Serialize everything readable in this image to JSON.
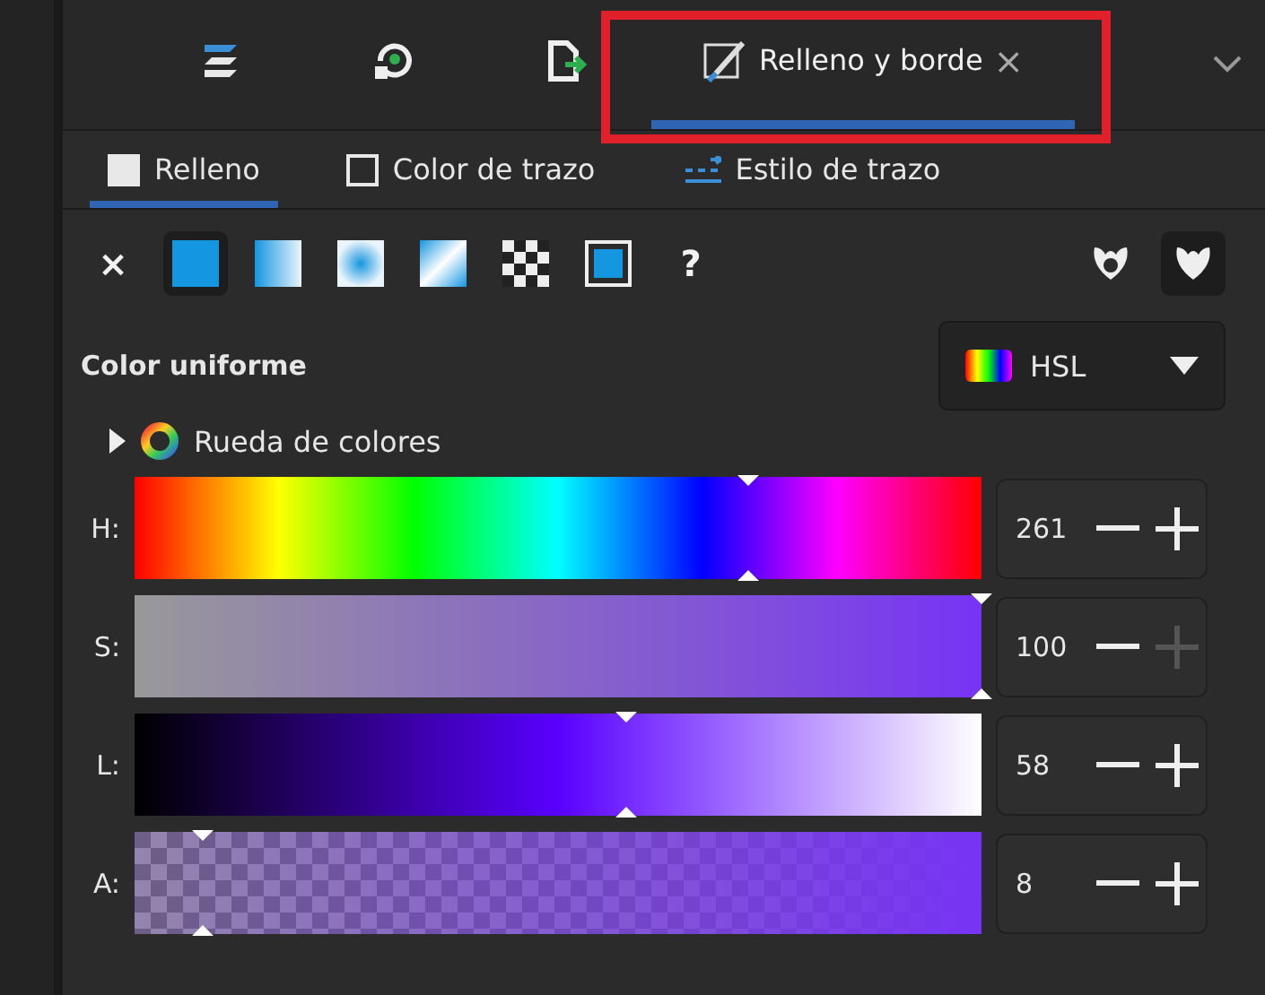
{
  "dock_tabs": [
    {
      "kind": "layers",
      "selected": false
    },
    {
      "kind": "history",
      "selected": false
    },
    {
      "kind": "export",
      "selected": false
    },
    {
      "kind": "fill",
      "label": "Relleno y borde",
      "close": "×",
      "selected": true,
      "highlighted": true
    }
  ],
  "subtabs": [
    {
      "kind": "fill",
      "label": "Relleno",
      "selected": true
    },
    {
      "kind": "stroke",
      "label": "Color de trazo",
      "selected": false
    },
    {
      "kind": "style",
      "label": "Estilo de trazo",
      "selected": false
    }
  ],
  "paint_types": [
    {
      "kind": "none",
      "glyph": "×",
      "selected": false
    },
    {
      "kind": "flat",
      "selected": true
    },
    {
      "kind": "linear",
      "selected": false
    },
    {
      "kind": "radial",
      "selected": false
    },
    {
      "kind": "mesh",
      "selected": false
    },
    {
      "kind": "pattern",
      "selected": false
    },
    {
      "kind": "swatch",
      "selected": false
    },
    {
      "kind": "unset",
      "glyph": "?",
      "selected": false
    }
  ],
  "fill_rules": [
    {
      "kind": "evenodd",
      "selected": false
    },
    {
      "kind": "nonzero",
      "selected": true
    }
  ],
  "mode_label": "Color uniforme",
  "color_mode": {
    "label": "HSL"
  },
  "wheel": {
    "label": "Rueda de colores",
    "expanded": false
  },
  "channels": [
    {
      "kind": "hue",
      "label": "H:",
      "level": 0.725,
      "value": "261",
      "plus_disabled": false
    },
    {
      "kind": "saturation",
      "label": "S:",
      "level": 1,
      "value": "100",
      "plus_disabled": true
    },
    {
      "kind": "lightness",
      "label": "L:",
      "level": 0.58,
      "value": "58",
      "plus_disabled": false
    },
    {
      "kind": "alpha",
      "label": "A:",
      "level": 0.08,
      "value": "8",
      "plus_disabled": false
    }
  ]
}
